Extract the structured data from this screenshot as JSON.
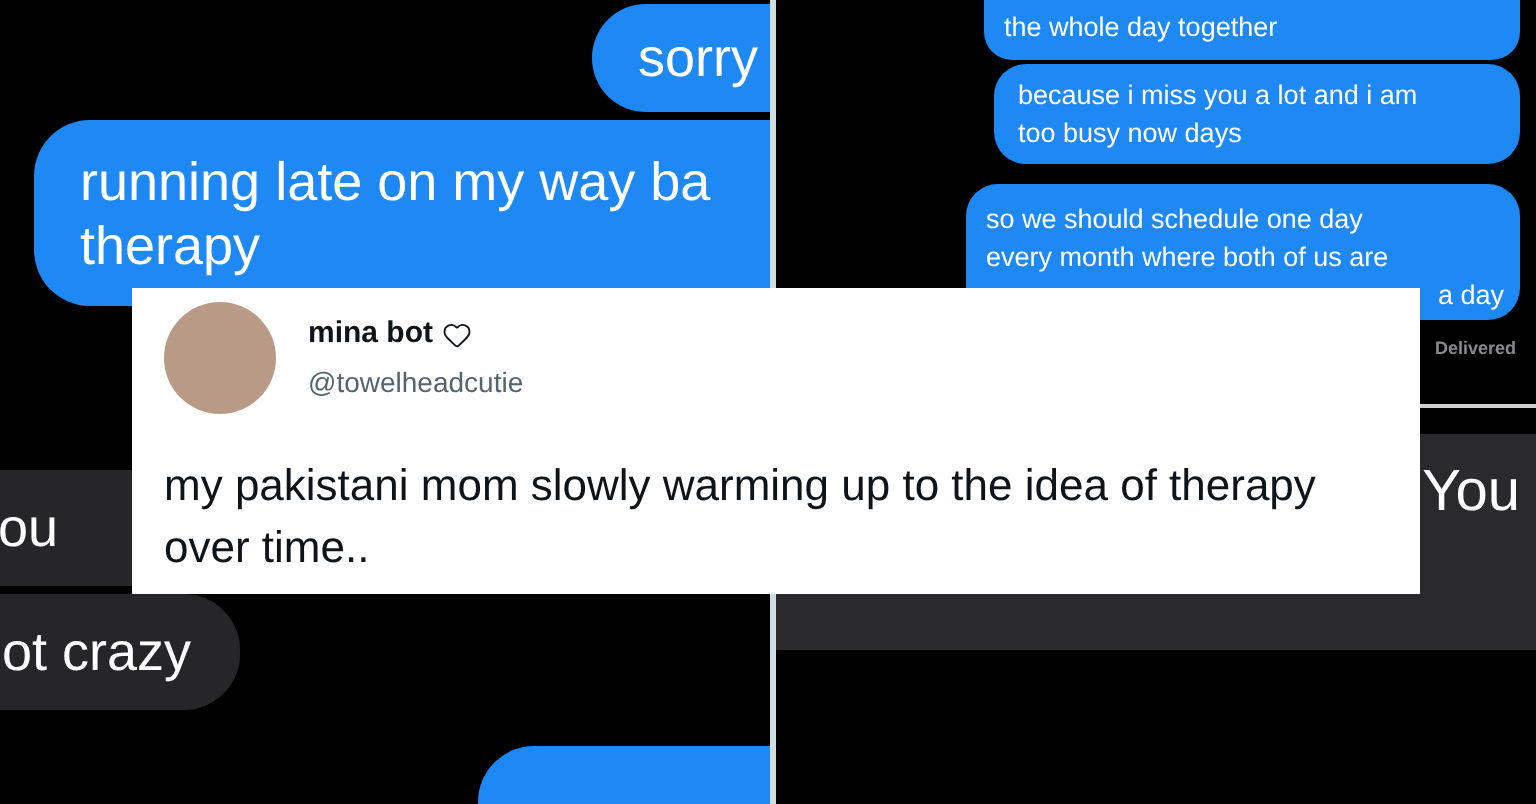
{
  "left_chat": {
    "messages": [
      {
        "kind": "sent",
        "lines": [
          "sorry"
        ]
      },
      {
        "kind": "sent",
        "lines": [
          "running late on my way ba",
          "therapy"
        ]
      },
      {
        "kind": "received",
        "lines": [
          "ou"
        ]
      },
      {
        "kind": "received",
        "lines": [
          "ot crazy"
        ]
      }
    ]
  },
  "right_chat": {
    "messages": [
      {
        "kind": "sent",
        "lines": [
          "the whole day together"
        ]
      },
      {
        "kind": "sent",
        "lines": [
          "because i miss you a lot and i am",
          "too busy now days"
        ]
      },
      {
        "kind": "sent",
        "lines": [
          "so we should schedule one day",
          "every month where both of us are",
          "a day"
        ]
      }
    ],
    "status": "Delivered"
  },
  "right_lower_chat": {
    "text": "You"
  },
  "tweet": {
    "name": "mina bot",
    "handle": "@towelheadcutie",
    "text": "my pakistani mom slowly warming up to the idea of therapy over time.."
  }
}
